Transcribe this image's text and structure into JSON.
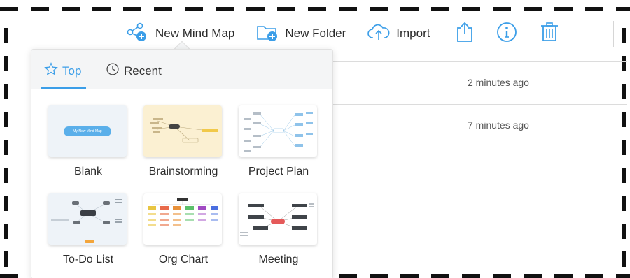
{
  "toolbar": {
    "new_mind_map": "New Mind Map",
    "new_folder": "New Folder",
    "import": "Import"
  },
  "file_rows": [
    {
      "time": "2 minutes ago"
    },
    {
      "time": "7 minutes ago"
    }
  ],
  "popover": {
    "tabs": [
      {
        "label": "Top",
        "active": true
      },
      {
        "label": "Recent",
        "active": false
      }
    ],
    "templates": [
      {
        "name": "Blank",
        "thumb_text": "My New Mind Map"
      },
      {
        "name": "Brainstorming"
      },
      {
        "name": "Project Plan"
      },
      {
        "name": "To-Do List"
      },
      {
        "name": "Org Chart"
      },
      {
        "name": "Meeting"
      }
    ]
  },
  "colors": {
    "accent": "#3b9ee8",
    "popover_header": "#f4f5f6",
    "brainstorm_bg": "#fbf0d2"
  }
}
